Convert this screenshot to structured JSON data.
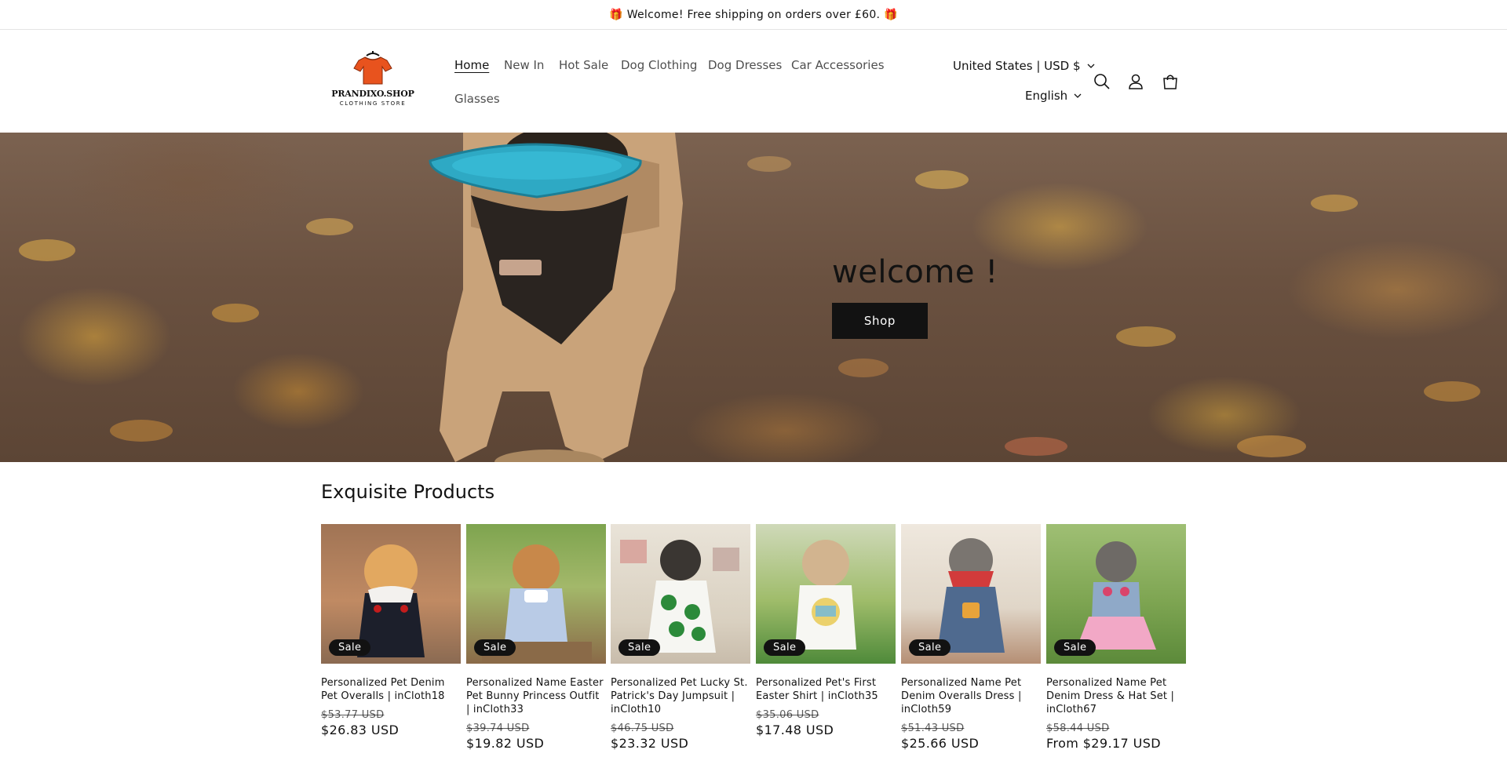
{
  "announcement": {
    "text": "🎁 Welcome! Free shipping on orders over £60. 🎁"
  },
  "logo": {
    "name": "PRANDIXO.SHOP",
    "tagline": "CLOTHING STORE"
  },
  "nav": {
    "items": [
      {
        "label": "Home",
        "active": true
      },
      {
        "label": "New In"
      },
      {
        "label": "Hot Sale"
      },
      {
        "label": "Dog Clothing"
      },
      {
        "label": "Dog Dresses"
      },
      {
        "label": "Car Accessories"
      },
      {
        "label": "Glasses"
      }
    ]
  },
  "localization": {
    "country": "United States | USD $",
    "language": "English"
  },
  "header_icons": [
    "search-icon",
    "account-icon",
    "cart-icon"
  ],
  "hero": {
    "title": "welcome !",
    "button": "Shop"
  },
  "products_section": {
    "title": "Exquisite Products",
    "products": [
      {
        "title": "Personalized Pet Denim Pet Overalls | inCloth18",
        "badge": "Sale",
        "was": "$53.77 USD",
        "price": "$26.83 USD"
      },
      {
        "title": "Personalized Name Easter Pet Bunny Princess Outfit | inCloth33",
        "badge": "Sale",
        "was": "$39.74 USD",
        "price": "$19.82 USD"
      },
      {
        "title": "Personalized Pet Lucky St. Patrick's Day Jumpsuit | inCloth10",
        "badge": "Sale",
        "was": "$46.75 USD",
        "price": "$23.32 USD"
      },
      {
        "title": "Personalized Pet's First Easter Shirt | inCloth35",
        "badge": "Sale",
        "was": "$35.06 USD",
        "price": "$17.48 USD"
      },
      {
        "title": "Personalized Name Pet Denim Overalls Dress | inCloth59",
        "badge": "Sale",
        "was": "$51.43 USD",
        "price": "$25.66 USD"
      },
      {
        "title": "Personalized Name Pet Denim Dress & Hat Set | inCloth67",
        "badge": "Sale",
        "was": "$58.44 USD",
        "price": "From $29.17 USD"
      }
    ]
  },
  "colors": {
    "text": "#121212",
    "button": "#121212",
    "background": "#ffffff",
    "logo_shirt": "#e8531e"
  }
}
